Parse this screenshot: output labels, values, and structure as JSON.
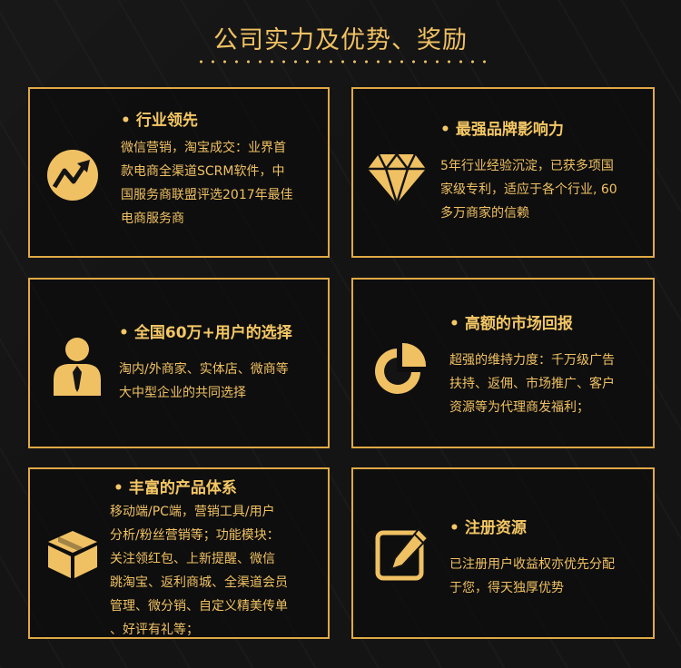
{
  "title": "公司实力及优势、奖励",
  "bullet": "•",
  "cards": [
    {
      "heading": "行业领先",
      "icon": "trend-chart-icon",
      "lines": [
        "微信营销，淘宝成交：业界首",
        "款电商全渠道SCRM软件，中",
        "国服务商联盟评选2017年最佳",
        "电商服务商"
      ]
    },
    {
      "heading": "最强品牌影响力",
      "icon": "diamond-icon",
      "lines": [
        "5年行业经验沉淀，已获多项国",
        "家级专利，适应于各个行业, 60",
        "多万商家的信赖"
      ]
    },
    {
      "heading": "全国60万+用户的选择",
      "icon": "user-icon",
      "lines": [
        "淘内/外商家、实体店、微商等",
        "大中型企业的共同选择"
      ]
    },
    {
      "heading": "高额的市场回报",
      "icon": "pie-chart-icon",
      "lines": [
        "超强的维持力度：千万级广告",
        "扶持、返佣、市场推广、客户",
        "资源等为代理商发福利；"
      ]
    },
    {
      "heading": "丰富的产品体系",
      "icon": "box-icon",
      "lines": [
        "移动端/PC端，营销工具/用户",
        "分析/粉丝营销等；功能模块：",
        "关注领红包、上新提醒、微信",
        "跳淘宝、返利商城、全渠道会员",
        "管理、微分销、自定义精美传单",
        "、好评有礼等；"
      ]
    },
    {
      "heading": "注册资源",
      "icon": "edit-icon",
      "lines": [
        "已注册用户收益权亦优先分配",
        "于您，得天独厚优势"
      ]
    }
  ]
}
